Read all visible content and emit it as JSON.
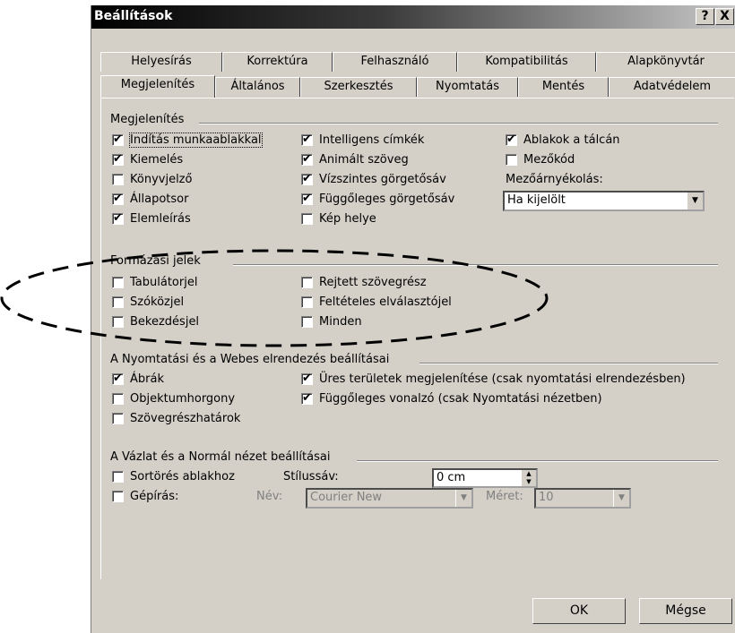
{
  "window": {
    "title": "Beállítások",
    "help_label": "?",
    "close_label": "X"
  },
  "tabs_back": [
    {
      "label": "Helyesírás"
    },
    {
      "label": "Korrektúra"
    },
    {
      "label": "Felhasználó"
    },
    {
      "label": "Kompatibilitás"
    },
    {
      "label": "Alapkönyvtár"
    }
  ],
  "tabs_front": [
    {
      "label": "Megjelenítés",
      "active": true
    },
    {
      "label": "Általános"
    },
    {
      "label": "Szerkesztés"
    },
    {
      "label": "Nyomtatás"
    },
    {
      "label": "Mentés"
    },
    {
      "label": "Adatvédelem"
    }
  ],
  "groups": {
    "display": {
      "title": "Megjelenítés",
      "items": [
        {
          "label": "Indítás munkaablakkal",
          "checked": true
        },
        {
          "label": "Kiemelés",
          "checked": true
        },
        {
          "label": "Könyvjelző",
          "checked": false
        },
        {
          "label": "Állapotsor",
          "checked": true
        },
        {
          "label": "Elemleírás",
          "checked": true
        },
        {
          "label": "Intelligens címkék",
          "checked": true
        },
        {
          "label": "Animált szöveg",
          "checked": true
        },
        {
          "label": "Vízszintes görgetősáv",
          "checked": true
        },
        {
          "label": "Függőleges görgetősáv",
          "checked": true
        },
        {
          "label": "Kép helye",
          "checked": false
        },
        {
          "label": "Ablakok a tálcán",
          "checked": true
        },
        {
          "label": "Mezőkód",
          "checked": false
        }
      ],
      "field_shading_label": "Mezőárnyékolás:",
      "field_shading_value": "Ha kijelölt"
    },
    "formatting": {
      "title": "Formázási jelek",
      "items": [
        {
          "label": "Tabulátorjel",
          "checked": false
        },
        {
          "label": "Szóközjel",
          "checked": false
        },
        {
          "label": "Bekezdésjel",
          "checked": false
        },
        {
          "label": "Rejtett szövegrész",
          "checked": false
        },
        {
          "label": "Feltételes elválasztójel",
          "checked": false
        },
        {
          "label": "Minden",
          "checked": false
        }
      ]
    },
    "print_web": {
      "title": "A Nyomtatási és a Webes elrendezés beállításai",
      "items": [
        {
          "label": "Ábrák",
          "checked": true
        },
        {
          "label": "Objektumhorgony",
          "checked": false
        },
        {
          "label": "Szövegrészhatárok",
          "checked": false
        },
        {
          "label": "Üres területek megjelenítése (csak nyomtatási elrendezésben)",
          "checked": true
        },
        {
          "label": "Függőleges vonalzó (csak Nyomtatási nézetben)",
          "checked": true
        }
      ]
    },
    "draft": {
      "title": "A Vázlat és a Normál nézet beállításai",
      "items": [
        {
          "label": "Sortörés ablakhoz",
          "checked": false
        },
        {
          "label": "Gépírás:",
          "checked": false
        }
      ],
      "style_area_label": "Stílussáv:",
      "style_area_value": "0 cm",
      "name_label": "Név:",
      "name_value": "Courier New",
      "size_label": "Méret:",
      "size_value": "10"
    }
  },
  "buttons": {
    "ok": "OK",
    "cancel": "Mégse"
  },
  "icons": {
    "check": "✔",
    "dropdown": "▼",
    "spin_up": "▲",
    "spin_down": "▼"
  }
}
